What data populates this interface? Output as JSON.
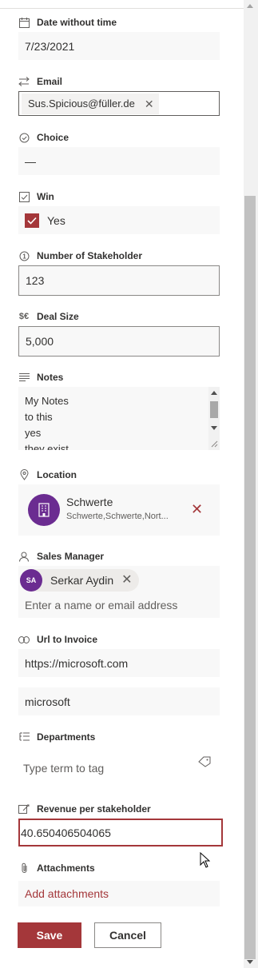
{
  "fields": {
    "date": {
      "label": "Date without time",
      "value": "7/23/2021"
    },
    "email": {
      "label": "Email",
      "value": "Sus.Spicious@füller.de"
    },
    "choice": {
      "label": "Choice",
      "value": "—"
    },
    "win": {
      "label": "Win",
      "checkbox_label": "Yes",
      "checked": true
    },
    "stakeholders": {
      "label": "Number of Stakeholder",
      "value": "123"
    },
    "deal_size": {
      "label": "Deal Size",
      "value": "5,000"
    },
    "notes": {
      "label": "Notes",
      "lines": [
        "My Notes",
        "to this",
        "yes",
        "they exist"
      ]
    },
    "location": {
      "label": "Location",
      "name": "Schwerte",
      "detail": "Schwerte,Schwerte,Nort..."
    },
    "sales_manager": {
      "label": "Sales Manager",
      "initials": "SA",
      "person": "Serkar Aydin",
      "placeholder": "Enter a name or email address"
    },
    "url": {
      "label": "Url to Invoice",
      "url": "https://microsoft.com",
      "description": "microsoft"
    },
    "departments": {
      "label": "Departments",
      "placeholder": "Type term to tag"
    },
    "revenue": {
      "label": "Revenue per stakeholder",
      "value": "40.650406504065"
    },
    "attachments": {
      "label": "Attachments",
      "add_label": "Add attachments"
    }
  },
  "actions": {
    "save_label": "Save",
    "cancel_label": "Cancel"
  },
  "colors": {
    "accent": "#a4373a",
    "location_icon_bg": "#6b2c91",
    "avatar_bg": "#6b2c91"
  }
}
